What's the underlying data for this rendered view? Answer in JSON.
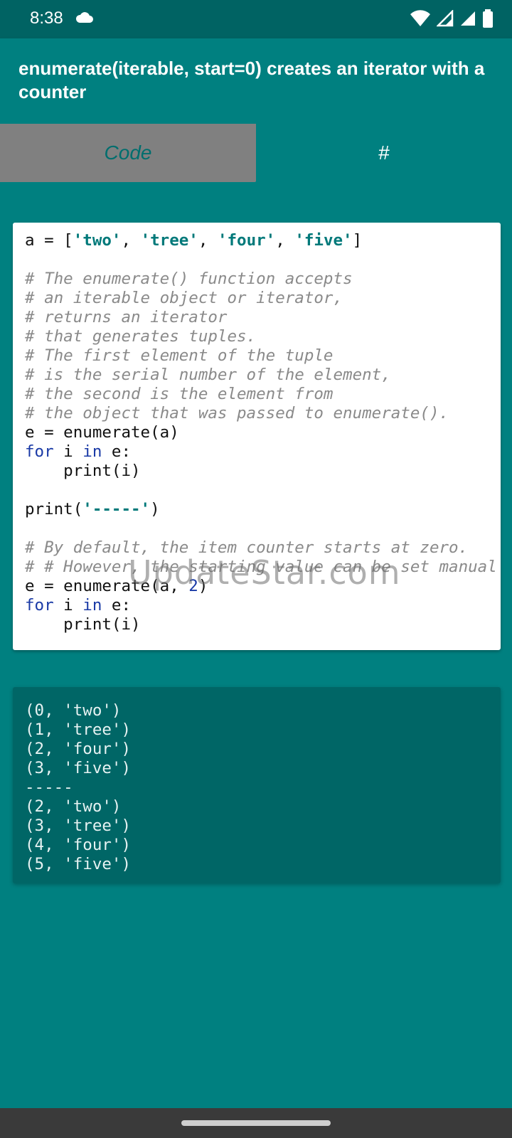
{
  "status": {
    "time": "8:38",
    "icons": [
      "cloud-icon",
      "wifi-icon",
      "signal-icon",
      "signal-icon",
      "battery-icon"
    ]
  },
  "header": {
    "title": "enumerate(iterable, start=0) creates an iterator with a counter"
  },
  "tabs": [
    {
      "label": "Code",
      "selected": true
    },
    {
      "label": "#",
      "selected": false
    }
  ],
  "code_lines": [
    "a = ['two', 'tree', 'four', 'five']",
    "",
    "# The enumerate() function accepts",
    "# an iterable object or iterator,",
    "# returns an iterator",
    "# that generates tuples.",
    "# The first element of the tuple",
    "# is the serial number of the element,",
    "# the second is the element from",
    "# the object that was passed to enumerate().",
    "e = enumerate(a)",
    "for i in e:",
    "    print(i)",
    "",
    "print('-----')",
    "",
    "# By default, the item counter starts at zero.",
    "# # However, the starting value can be set manual",
    "e = enumerate(a, 2)",
    "for i in e:",
    "    print(i)"
  ],
  "output_lines": [
    "(0, 'two')",
    "(1, 'tree')",
    "(2, 'four')",
    "(3, 'five')",
    "-----",
    "(2, 'two')",
    "(3, 'tree')",
    "(4, 'four')",
    "(5, 'five')"
  ],
  "watermark": "UpdateStar.com",
  "colors": {
    "accent": "#008080",
    "statusbar": "#006363",
    "output_bg": "#006666",
    "tab_selected_bg": "#808080"
  }
}
